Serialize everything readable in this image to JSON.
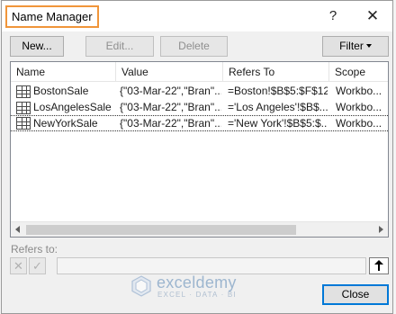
{
  "dialog": {
    "title": "Name Manager",
    "help_label": "?",
    "close_label": "✕"
  },
  "toolbar": {
    "new_label": "New...",
    "edit_label": "Edit...",
    "delete_label": "Delete",
    "filter_label": "Filter"
  },
  "table": {
    "columns": [
      "Name",
      "Value",
      "Refers To",
      "Scope"
    ],
    "rows": [
      {
        "name": "BostonSale",
        "value": "{\"03-Mar-22\",\"Bran\"...",
        "refers_to": "=Boston!$B$5:$F$12",
        "scope": "Workbo..."
      },
      {
        "name": "LosAngelesSale",
        "value": "{\"03-Mar-22\",\"Bran\"...",
        "refers_to": "='Los Angeles'!$B$...",
        "scope": "Workbo..."
      },
      {
        "name": "NewYorkSale",
        "value": "{\"03-Mar-22\",\"Bran\"...",
        "refers_to": "='New York'!$B$5:$...",
        "scope": "Workbo..."
      }
    ]
  },
  "refers": {
    "label": "Refers to:",
    "cancel_glyph": "✕",
    "confirm_glyph": "✓",
    "value": ""
  },
  "footer": {
    "close_label": "Close"
  },
  "watermark": {
    "name": "exceldemy",
    "tagline": "EXCEL · DATA · BI"
  }
}
